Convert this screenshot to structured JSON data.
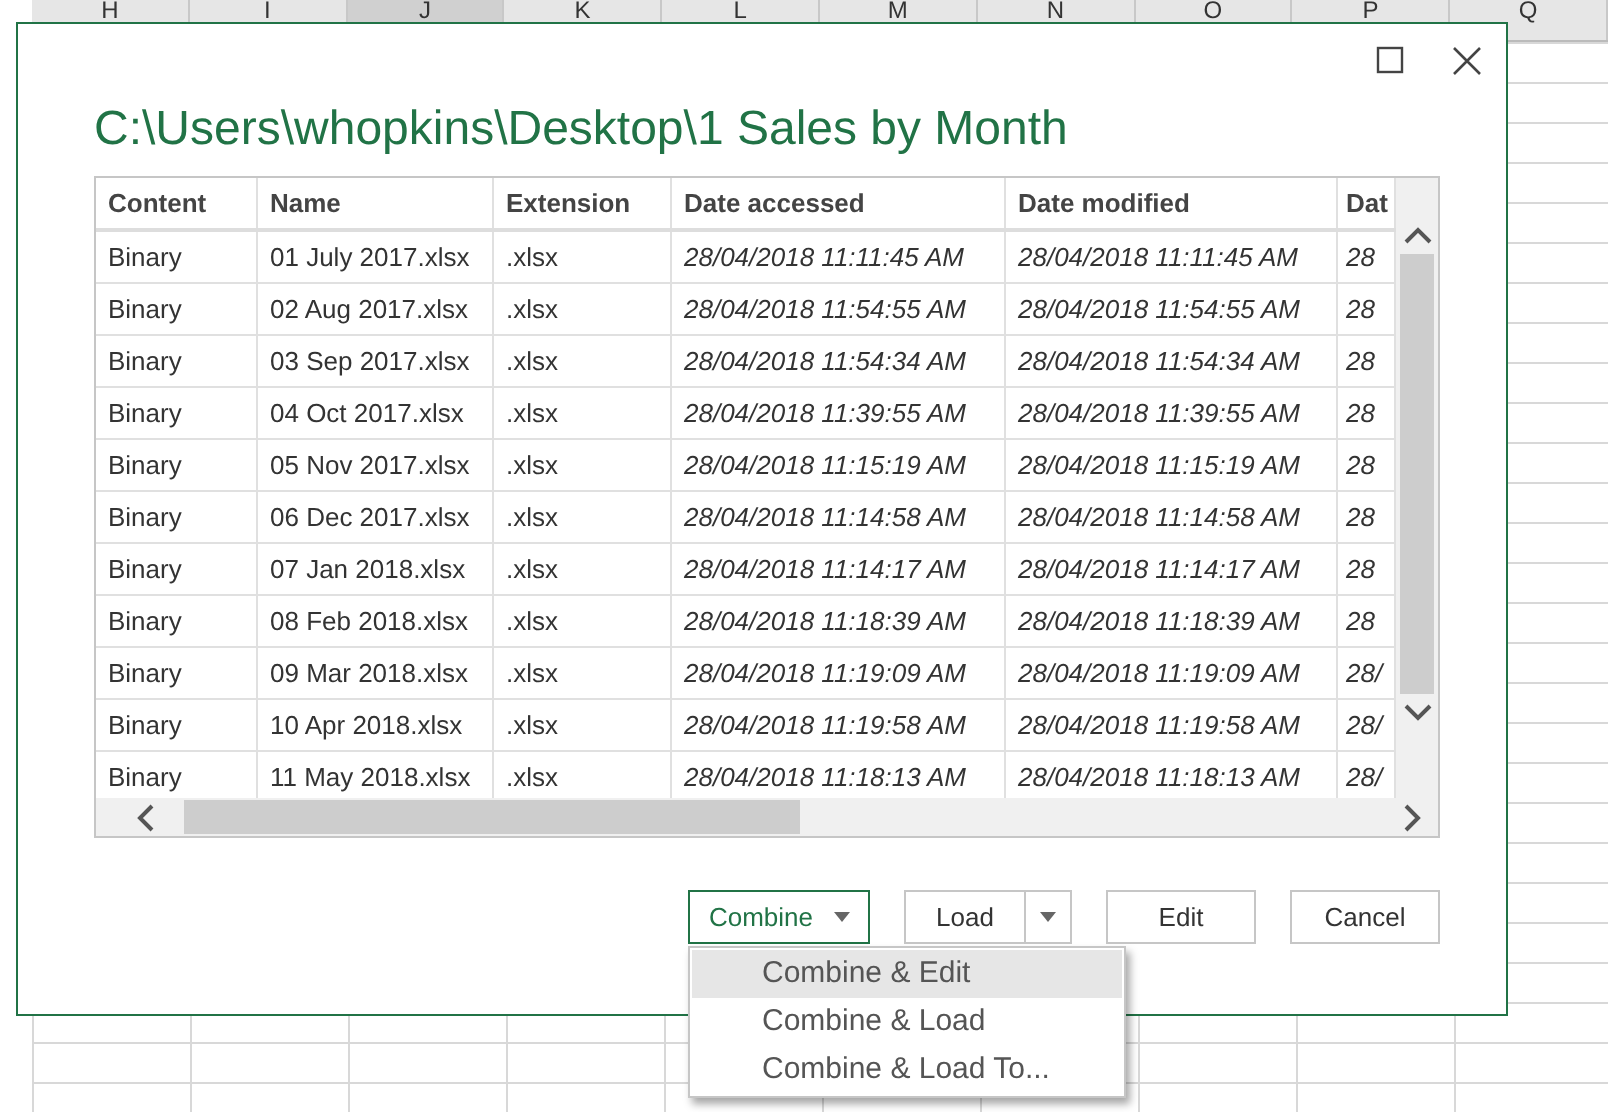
{
  "sheet": {
    "columns": [
      {
        "label": "H",
        "selected": false
      },
      {
        "label": "I",
        "selected": false
      },
      {
        "label": "J",
        "selected": true
      },
      {
        "label": "K",
        "selected": false
      },
      {
        "label": "L",
        "selected": false
      },
      {
        "label": "M",
        "selected": false
      },
      {
        "label": "N",
        "selected": false
      },
      {
        "label": "O",
        "selected": false
      },
      {
        "label": "P",
        "selected": false
      },
      {
        "label": "Q",
        "selected": false
      }
    ]
  },
  "dialog": {
    "title": "C:\\Users\\whopkins\\Desktop\\1 Sales by Month",
    "table": {
      "columns": [
        "Content",
        "Name",
        "Extension",
        "Date accessed",
        "Date modified",
        "Dat"
      ],
      "rows": [
        [
          "Binary",
          "01 July 2017.xlsx",
          ".xlsx",
          "28/04/2018 11:11:45 AM",
          "28/04/2018 11:11:45 AM",
          "28"
        ],
        [
          "Binary",
          "02 Aug 2017.xlsx",
          ".xlsx",
          "28/04/2018 11:54:55 AM",
          "28/04/2018 11:54:55 AM",
          "28"
        ],
        [
          "Binary",
          "03 Sep 2017.xlsx",
          ".xlsx",
          "28/04/2018 11:54:34 AM",
          "28/04/2018 11:54:34 AM",
          "28"
        ],
        [
          "Binary",
          "04 Oct 2017.xlsx",
          ".xlsx",
          "28/04/2018 11:39:55 AM",
          "28/04/2018 11:39:55 AM",
          "28"
        ],
        [
          "Binary",
          "05 Nov 2017.xlsx",
          ".xlsx",
          "28/04/2018 11:15:19 AM",
          "28/04/2018 11:15:19 AM",
          "28"
        ],
        [
          "Binary",
          "06 Dec 2017.xlsx",
          ".xlsx",
          "28/04/2018 11:14:58 AM",
          "28/04/2018 11:14:58 AM",
          "28"
        ],
        [
          "Binary",
          "07 Jan 2018.xlsx",
          ".xlsx",
          "28/04/2018 11:14:17 AM",
          "28/04/2018 11:14:17 AM",
          "28"
        ],
        [
          "Binary",
          "08 Feb 2018.xlsx",
          ".xlsx",
          "28/04/2018 11:18:39 AM",
          "28/04/2018 11:18:39 AM",
          "28"
        ],
        [
          "Binary",
          "09 Mar 2018.xlsx",
          ".xlsx",
          "28/04/2018 11:19:09 AM",
          "28/04/2018 11:19:09 AM",
          "28/"
        ],
        [
          "Binary",
          "10 Apr 2018.xlsx",
          ".xlsx",
          "28/04/2018 11:19:58 AM",
          "28/04/2018 11:19:58 AM",
          "28/"
        ],
        [
          "Binary",
          "11 May 2018.xlsx",
          ".xlsx",
          "28/04/2018 11:18:13 AM",
          "28/04/2018 11:18:13 AM",
          "28/"
        ]
      ]
    },
    "buttons": [
      {
        "label": "Combine",
        "kind": "dropdown",
        "selected": true
      },
      {
        "label": "Load",
        "kind": "split",
        "selected": false
      },
      {
        "label": "Edit",
        "kind": "plain",
        "selected": false
      },
      {
        "label": "Cancel",
        "kind": "plain",
        "selected": false
      }
    ],
    "menu": [
      {
        "label": "Combine & Edit",
        "selected": true
      },
      {
        "label": "Combine & Load",
        "selected": false
      },
      {
        "label": "Combine & Load To...",
        "selected": false
      }
    ]
  }
}
